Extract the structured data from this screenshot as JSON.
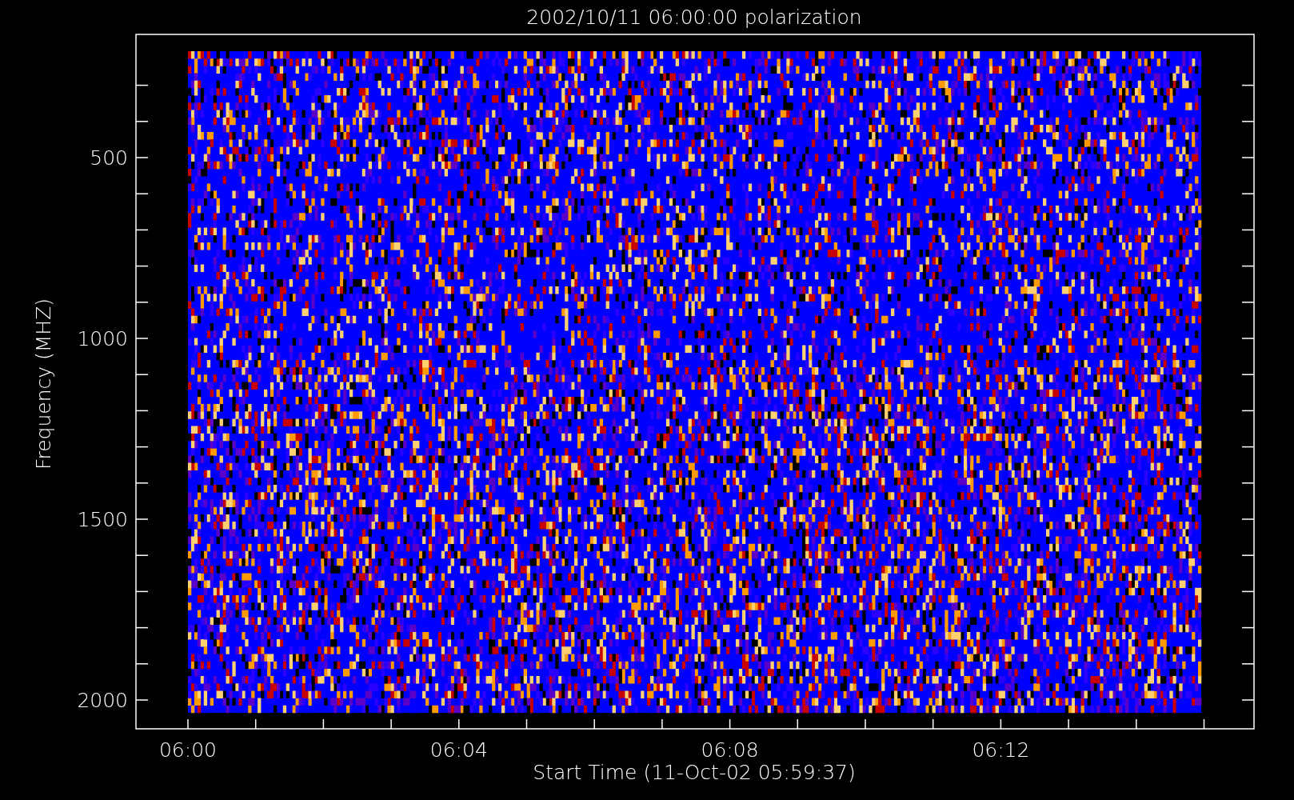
{
  "title": "2002/10/11 06:00:00 polarization",
  "y_axis": {
    "label": "Frequency (MHZ)",
    "ticks": [
      "500",
      "1000",
      "1500",
      "2000"
    ]
  },
  "x_axis": {
    "label": "Start Time (11-Oct-02 05:59:37)",
    "ticks": [
      "06:00",
      "06:04",
      "06:08",
      "06:12"
    ]
  }
}
